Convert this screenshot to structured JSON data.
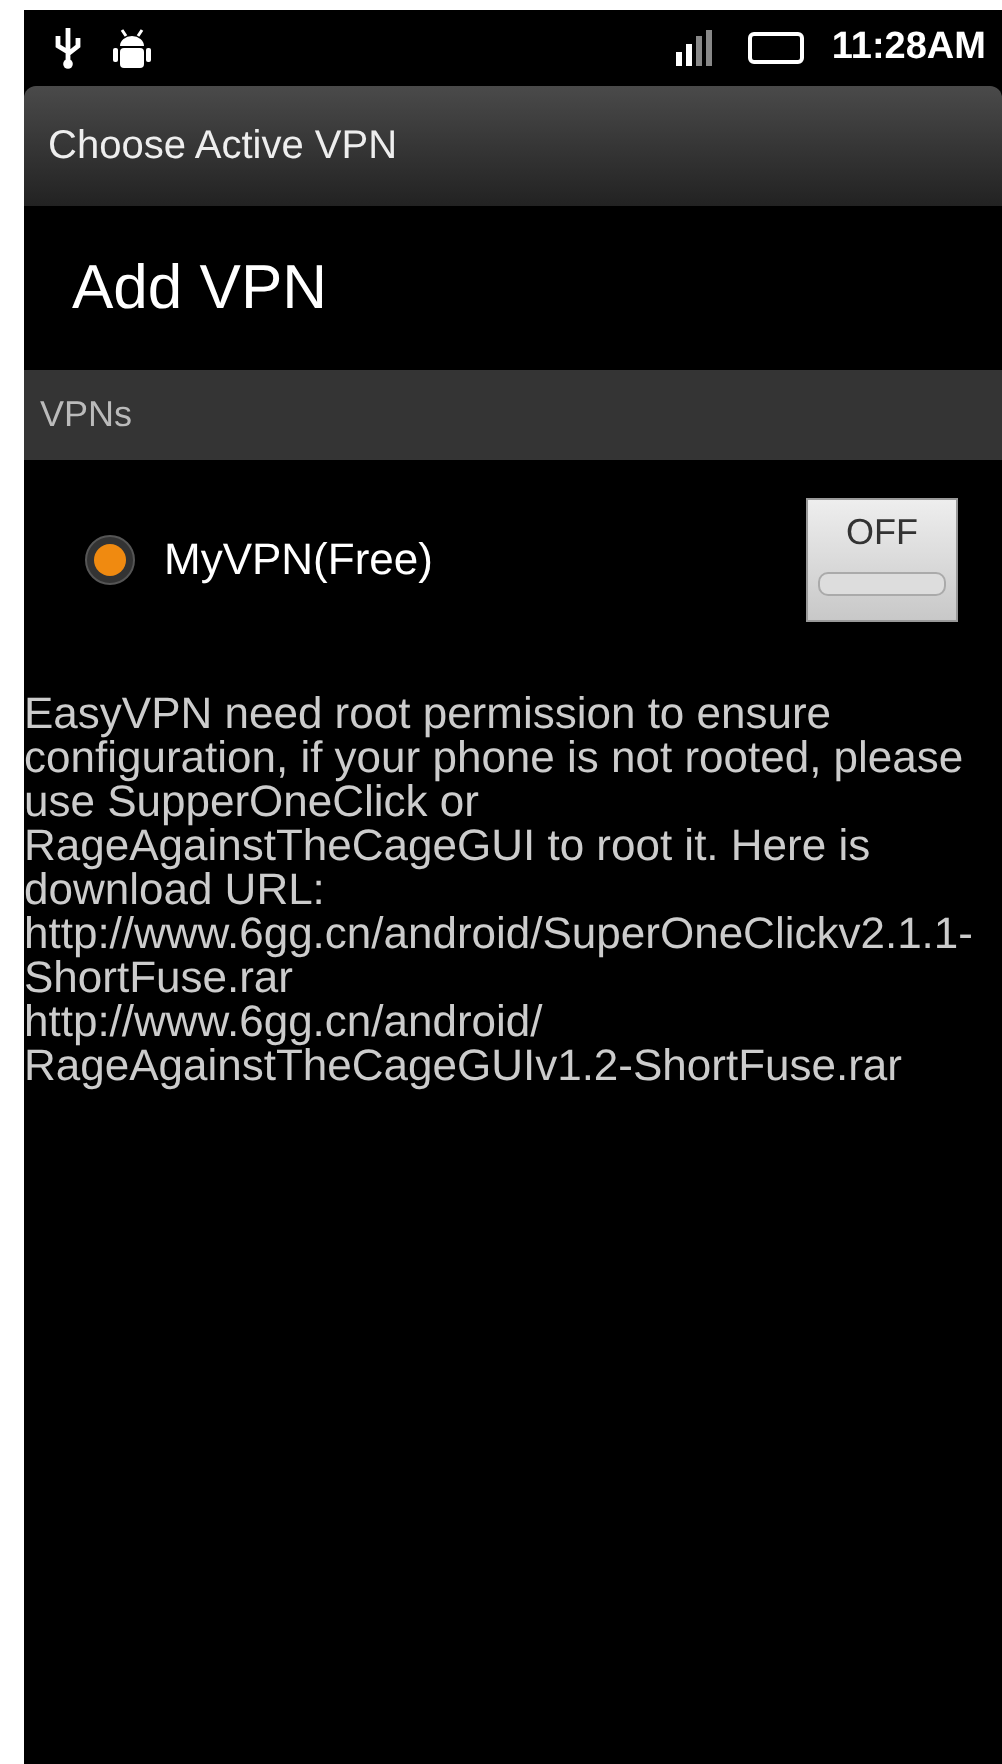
{
  "status_bar": {
    "time": "11:28AM"
  },
  "title_bar": {
    "title": "Choose Active VPN"
  },
  "add_item": {
    "label": "Add VPN"
  },
  "section": {
    "header": "VPNs"
  },
  "vpns": [
    {
      "name": "MyVPN(Free)",
      "selected": true,
      "toggle": {
        "label": "OFF",
        "on": false
      }
    }
  ],
  "notice": {
    "lines": [
      "EasyVPN need root permission to ensure",
      "configuration, if your phone is not rooted, please",
      "use SupperOneClick or",
      "RageAgainstTheCageGUI to root it. Here is",
      "download URL:",
      "http://www.6gg.cn/android/SuperOneClickv2.1.1-",
      "ShortFuse.rar",
      "http://www.6gg.cn/android/",
      "RageAgainstTheCageGUIv1.2-ShortFuse.rar"
    ]
  }
}
